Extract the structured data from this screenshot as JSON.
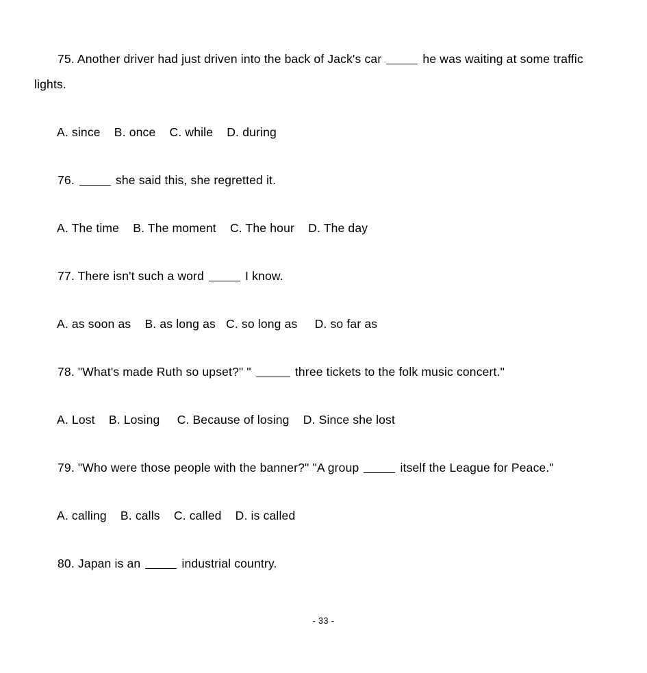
{
  "document": {
    "type": "exam-worksheet",
    "page_footer": "- 33 -",
    "background_color": "#ffffff",
    "text_color": "#000000"
  },
  "questions": [
    {
      "number": "75.",
      "text_before_blank": "75. Another driver had just driven into the back of Jack's car ",
      "text_after_blank": " he was waiting at some traffic lights.",
      "full_text": "75. Another driver had just driven into the back of Jack's car _____ he was waiting at some traffic lights.",
      "options_line": "A. since    B. once    C. while    D. during",
      "options": [
        {
          "letter": "A.",
          "label": "since"
        },
        {
          "letter": "B.",
          "label": "once"
        },
        {
          "letter": "C.",
          "label": "while"
        },
        {
          "letter": "D.",
          "label": "during"
        }
      ]
    },
    {
      "number": "76.",
      "text_before_blank": "76. ",
      "text_after_blank": " she said this, she regretted it.",
      "full_text": "76. _____ she said this, she regretted it.",
      "options_line": "A. The time    B. The moment    C. The hour    D. The day",
      "options": [
        {
          "letter": "A.",
          "label": "The time"
        },
        {
          "letter": "B.",
          "label": "The moment"
        },
        {
          "letter": "C.",
          "label": "The hour"
        },
        {
          "letter": "D.",
          "label": "The day"
        }
      ]
    },
    {
      "number": "77.",
      "text_before_blank": "77. There isn't such a word ",
      "text_after_blank": " I know.",
      "full_text": "77. There isn't such a word _____ I know.",
      "options_line": "A. as soon as    B. as long as   C. so long as     D. so far as",
      "options": [
        {
          "letter": "A.",
          "label": "as soon as"
        },
        {
          "letter": "B.",
          "label": "as long as"
        },
        {
          "letter": "C.",
          "label": "so long as"
        },
        {
          "letter": "D.",
          "label": "so far as"
        }
      ]
    },
    {
      "number": "78.",
      "text_before_blank": "78. \"What's made Ruth so upset?\" \" ",
      "text_after_blank": " three tickets to the folk music concert.\"",
      "full_text": "78. \"What's made Ruth so upset?\" \" _____ three tickets to the folk music concert.\"",
      "options_line": "A. Lost    B. Losing     C. Because of losing    D. Since she lost",
      "options": [
        {
          "letter": "A.",
          "label": "Lost"
        },
        {
          "letter": "B.",
          "label": "Losing"
        },
        {
          "letter": "C.",
          "label": "Because of losing"
        },
        {
          "letter": "D.",
          "label": "Since she lost"
        }
      ]
    },
    {
      "number": "79.",
      "text_before_blank": "79. \"Who were those people with the banner?\" \"A group ",
      "text_after_blank": " itself the League for Peace.\"",
      "full_text": "79. \"Who were those people with the banner?\" \"A group _____ itself the League for Peace.\"",
      "options_line": "A. calling    B. calls    C. called    D. is called",
      "options": [
        {
          "letter": "A.",
          "label": "calling"
        },
        {
          "letter": "B.",
          "label": "calls"
        },
        {
          "letter": "C.",
          "label": "called"
        },
        {
          "letter": "D.",
          "label": "is called"
        }
      ]
    },
    {
      "number": "80.",
      "text_before_blank": "80. Japan is an ",
      "text_after_blank": " industrial country.",
      "full_text": "80. Japan is an _____ industrial country.",
      "options_line": "",
      "options": []
    }
  ]
}
